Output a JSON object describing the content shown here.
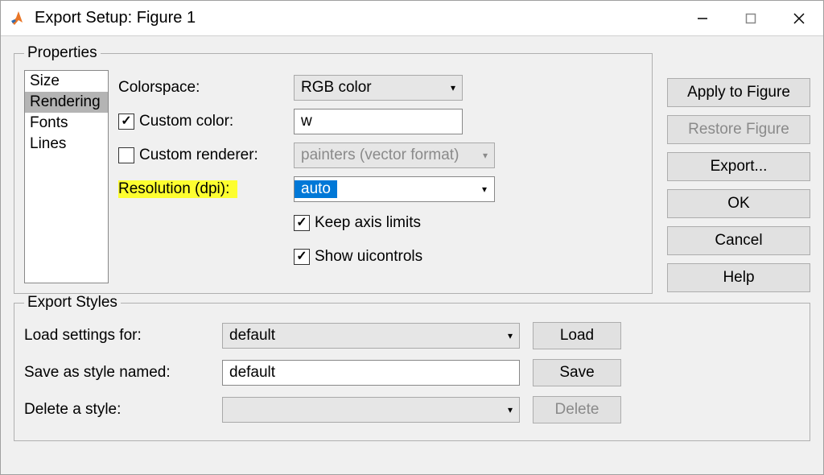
{
  "titlebar": {
    "title": "Export Setup: Figure 1"
  },
  "properties": {
    "legend": "Properties",
    "categories": [
      "Size",
      "Rendering",
      "Fonts",
      "Lines"
    ],
    "selected_index": 1,
    "labels": {
      "colorspace": "Colorspace:",
      "custom_color": "Custom color:",
      "custom_renderer": "Custom renderer:",
      "resolution": "Resolution (dpi):",
      "keep_axis": "Keep axis limits",
      "show_uicontrols": "Show uicontrols"
    },
    "values": {
      "colorspace": "RGB color",
      "custom_color_checked": true,
      "custom_color_value": "w",
      "custom_renderer_checked": false,
      "custom_renderer_value": "painters (vector format)",
      "resolution_value": "auto",
      "keep_axis_checked": true,
      "show_uicontrols_checked": true
    }
  },
  "buttons": {
    "apply": "Apply to Figure",
    "restore": "Restore Figure",
    "export": "Export...",
    "ok": "OK",
    "cancel": "Cancel",
    "help": "Help"
  },
  "export_styles": {
    "legend": "Export Styles",
    "load_label": "Load settings for:",
    "load_value": "default",
    "load_btn": "Load",
    "save_label": "Save as style named:",
    "save_value": "default",
    "save_btn": "Save",
    "delete_label": "Delete a style:",
    "delete_value": "",
    "delete_btn": "Delete"
  }
}
